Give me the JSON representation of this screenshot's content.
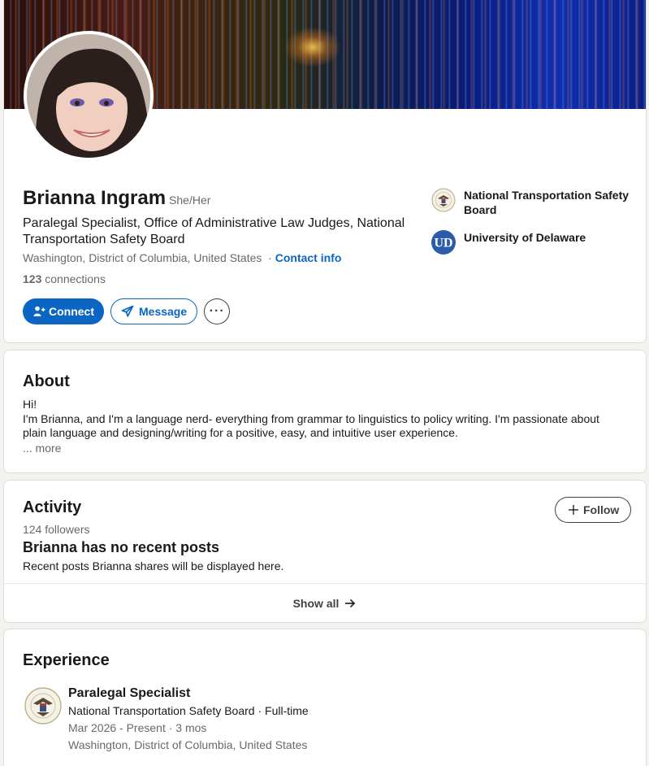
{
  "profile": {
    "name": "Brianna Ingram",
    "pronouns": "She/Her",
    "headline": "Paralegal Specialist, Office of Administrative Law Judges, National Transportation Safety Board",
    "location": "Washington, District of Columbia, United States",
    "location_separator": "·",
    "contact_info": "Contact info",
    "connections_count": "123",
    "connections_label": "connections",
    "avatar_icon": "profile-photo"
  },
  "actions": {
    "connect_label": "Connect",
    "message_label": "Message",
    "more_label": "···"
  },
  "right_links": [
    {
      "label": "National Transportation Safety Board",
      "icon": "ntsb-seal-icon"
    },
    {
      "label": "University of Delaware",
      "icon": "ud-logo-icon"
    }
  ],
  "about": {
    "title": "About",
    "line1": "Hi!",
    "body": "I'm Brianna, and I'm a language nerd- everything from grammar to linguistics to policy writing. I'm passionate about plain language and designing/writing for a positive, easy, and intuitive user experience.",
    "more": "... more"
  },
  "activity": {
    "title": "Activity",
    "followers": "124 followers",
    "follow_label": "Follow",
    "empty_title": "Brianna has no recent posts",
    "empty_sub": "Recent posts Brianna shares will be displayed here.",
    "show_all": "Show all"
  },
  "experience": {
    "title": "Experience",
    "items": [
      {
        "role": "Paralegal Specialist",
        "company": "National Transportation Safety Board · Full-time",
        "dates": "Mar 2026 - Present · 3 mos",
        "location": "Washington, District of Columbia, United States"
      }
    ]
  },
  "colors": {
    "accent": "#0a66c2",
    "page_bg": "#f3f2ef",
    "ud_blue": "#2a5ca8"
  }
}
